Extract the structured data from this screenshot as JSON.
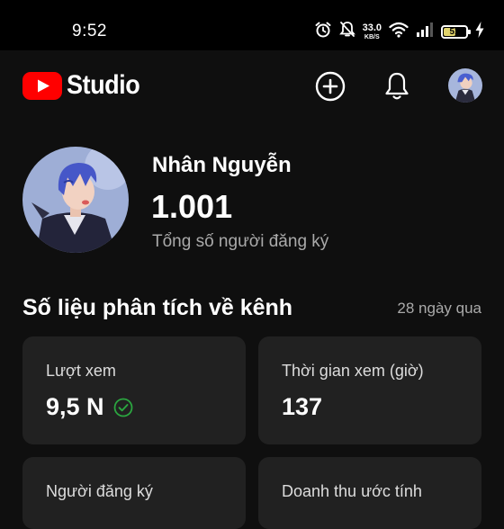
{
  "status_bar": {
    "time": "9:52",
    "net_speed_value": "33.0",
    "net_speed_unit": "KB/S",
    "battery": "51",
    "icons": [
      "alarm-icon",
      "mute-bell-icon",
      "wifi-icon",
      "signal-icon",
      "battery-icon",
      "charging-icon"
    ]
  },
  "header": {
    "logo_text": "Studio",
    "brand_color": "#ff0000",
    "actions": [
      "create-plus-icon",
      "notifications-bell-icon",
      "account-avatar"
    ]
  },
  "channel": {
    "name": "Nhân Nguyễn",
    "subscribers": "1.001",
    "subscribers_label": "Tổng số người đăng ký"
  },
  "analytics": {
    "title": "Số liệu phân tích về kênh",
    "period": "28 ngày qua",
    "cards": [
      {
        "label": "Lượt xem",
        "value": "9,5 N",
        "icon": "check-circle-icon",
        "icon_color": "#2ba640"
      },
      {
        "label": "Thời gian xem (giờ)",
        "value": "137"
      },
      {
        "label": "Người đăng ký",
        "value": ""
      },
      {
        "label": "Doanh thu ước tính",
        "value": ""
      }
    ]
  }
}
